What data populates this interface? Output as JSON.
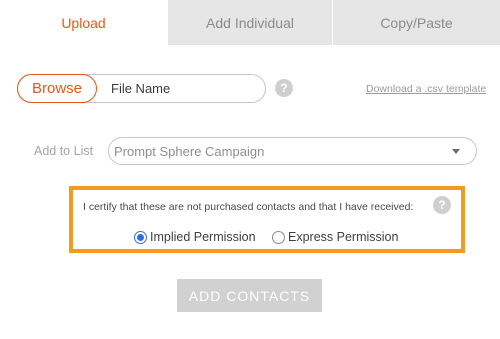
{
  "tabs": [
    {
      "label": "Upload",
      "active": true
    },
    {
      "label": "Add Individual",
      "active": false
    },
    {
      "label": "Copy/Paste",
      "active": false
    }
  ],
  "upload": {
    "browse_label": "Browse",
    "file_name": "File Name",
    "help_icon": "?",
    "csv_link": "Download a .csv template"
  },
  "list": {
    "label": "Add to List",
    "selected": "Prompt Sphere Campaign"
  },
  "certify": {
    "text": "I certify that these are not purchased contacts and that I have received:",
    "help_icon": "?",
    "options": [
      {
        "label": "Implied Permission",
        "checked": true
      },
      {
        "label": "Express Permission",
        "checked": false
      }
    ]
  },
  "add_button_label": "ADD CONTACTS",
  "colors": {
    "accent": "#e8571a",
    "highlight_border": "#f39a20",
    "radio_selected": "#2e6fd8",
    "disabled_button": "#d1d1d1"
  }
}
